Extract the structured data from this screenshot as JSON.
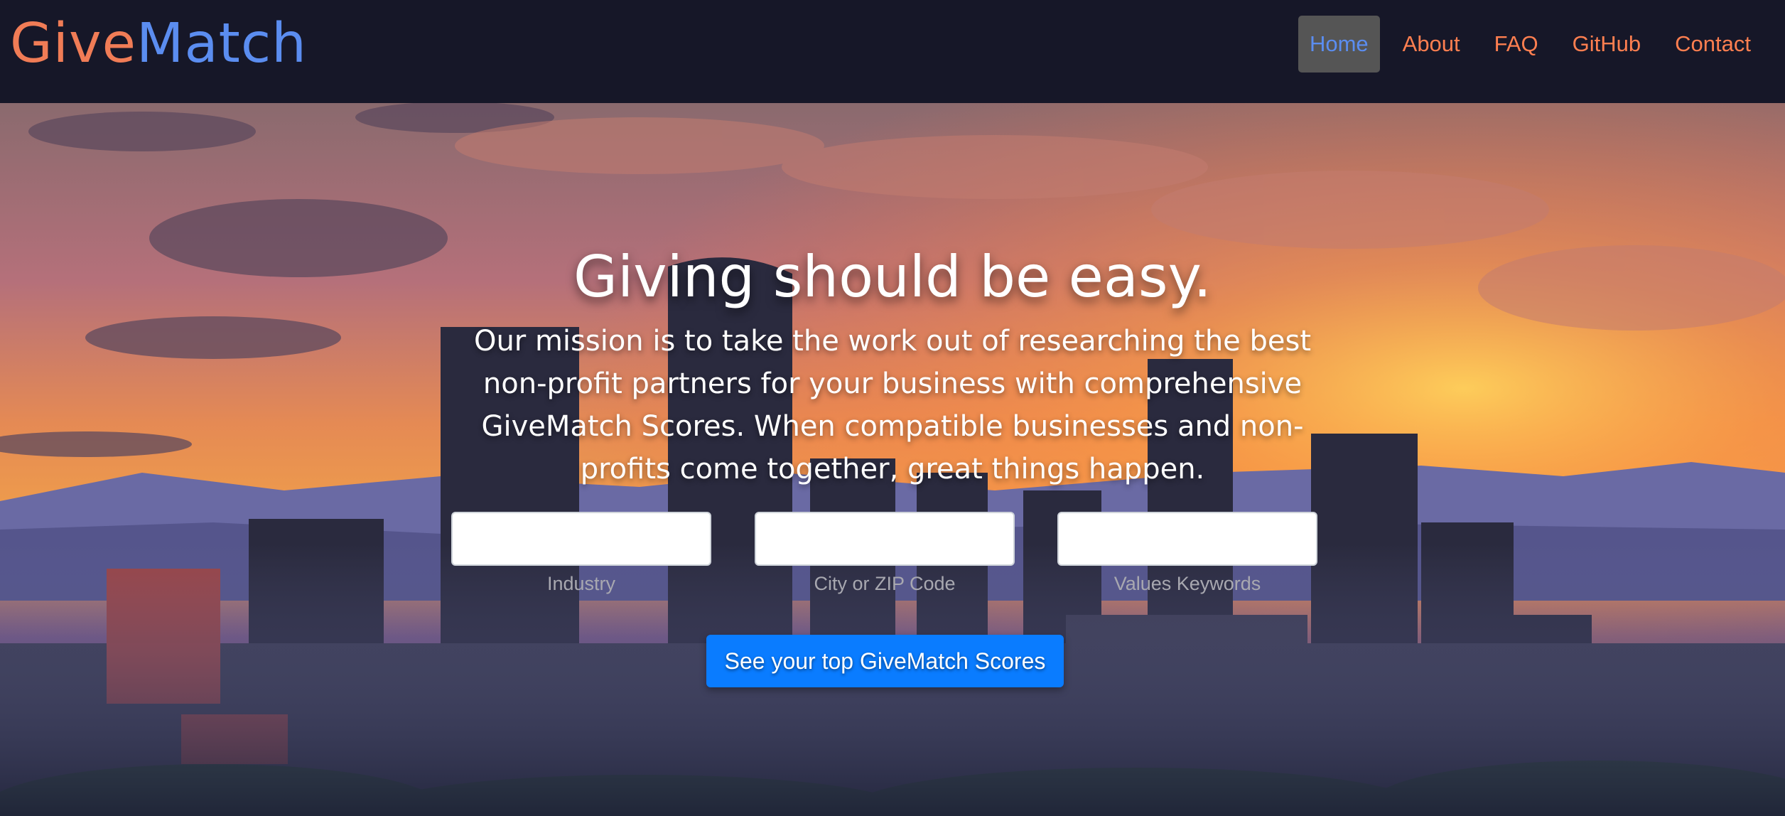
{
  "brand": {
    "part1": "Give",
    "part2": "Match"
  },
  "nav": {
    "items": [
      {
        "label": "Home",
        "active": true
      },
      {
        "label": "About"
      },
      {
        "label": "FAQ"
      },
      {
        "label": "GitHub"
      },
      {
        "label": "Contact"
      }
    ]
  },
  "hero": {
    "headline": "Giving should be easy.",
    "mission": "Our mission is to take the work out of researching the best non-profit partners for your business with comprehensive GiveMatch Scores. When compatible businesses and non-profits come together, great things happen.",
    "fields": [
      {
        "label": "Industry",
        "value": ""
      },
      {
        "label": "City or ZIP Code",
        "value": ""
      },
      {
        "label": "Values Keywords",
        "value": ""
      }
    ],
    "cta_label": "See your top GiveMatch Scores"
  },
  "colors": {
    "navbar_bg": "#161728",
    "brand_give": "#f07c56",
    "brand_match": "#5b8df0",
    "nav_link": "#ff7f50",
    "cta_bg": "#0a7cff"
  }
}
